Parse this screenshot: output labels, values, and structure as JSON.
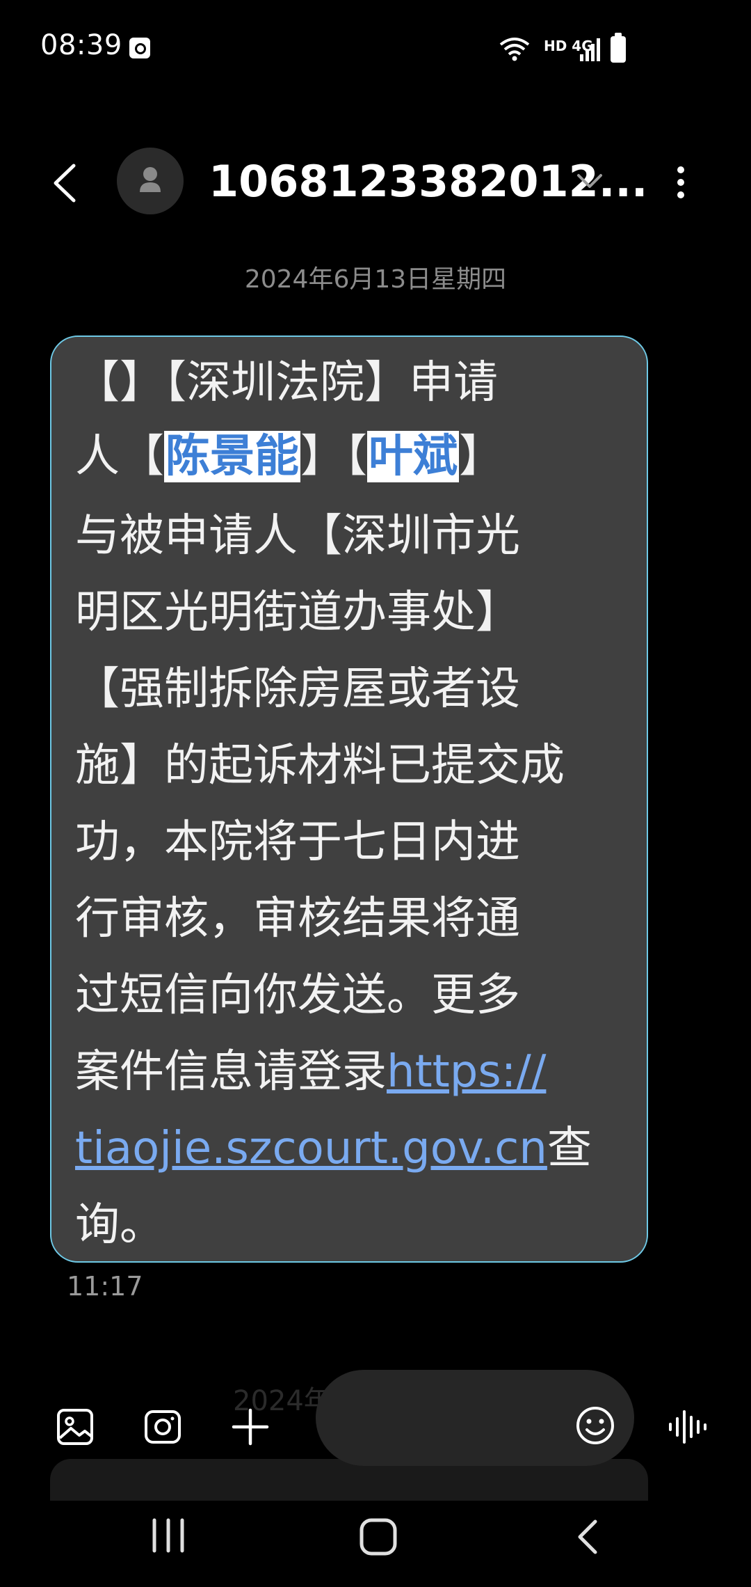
{
  "status_bar": {
    "time": "08:39",
    "network_label": "HD 4G"
  },
  "header": {
    "contact": "1068123382012...",
    "icons": [
      "back-icon",
      "avatar-person-icon",
      "chevron-down-icon",
      "more-vert-icon"
    ]
  },
  "conversation": {
    "date": "2024年6月13日星期四",
    "message": {
      "line1": "【】【深圳法院】申请",
      "line2_a": "人【",
      "line2_name1": "陈景能",
      "line2_b": "】【",
      "line2_name2": "叶斌",
      "line2_c": "】",
      "line3": "与被申请人【深圳市光",
      "line4": "明区光明街道办事处】",
      "line5": "【强制拆除房屋或者设",
      "line6": "施】的起诉材料已提交成",
      "line7": "功，本院将于七日内进",
      "line8": "行审核，审核结果将通",
      "line9": "过短信向你发送。更多",
      "line10_text": "案件信息请登录",
      "line10_link": "https://",
      "line11_link": "tiaojie.szcourt.gov.cn",
      "line11_text": "查",
      "line12": "询。"
    },
    "time": "11:17",
    "next_date_peek": "2024年"
  },
  "compose": {
    "icons": [
      "gallery-icon",
      "camera-icon",
      "plus-icon",
      "emoji-icon",
      "voice-icon"
    ]
  },
  "nav": {
    "icons": [
      "recents-icon",
      "home-icon",
      "nav-back-icon"
    ]
  },
  "colors": {
    "bubble_bg": "#404040",
    "bubble_border": "#6ec9e6",
    "link": "#7aaaf0",
    "highlight_text": "#3d7fd6"
  }
}
